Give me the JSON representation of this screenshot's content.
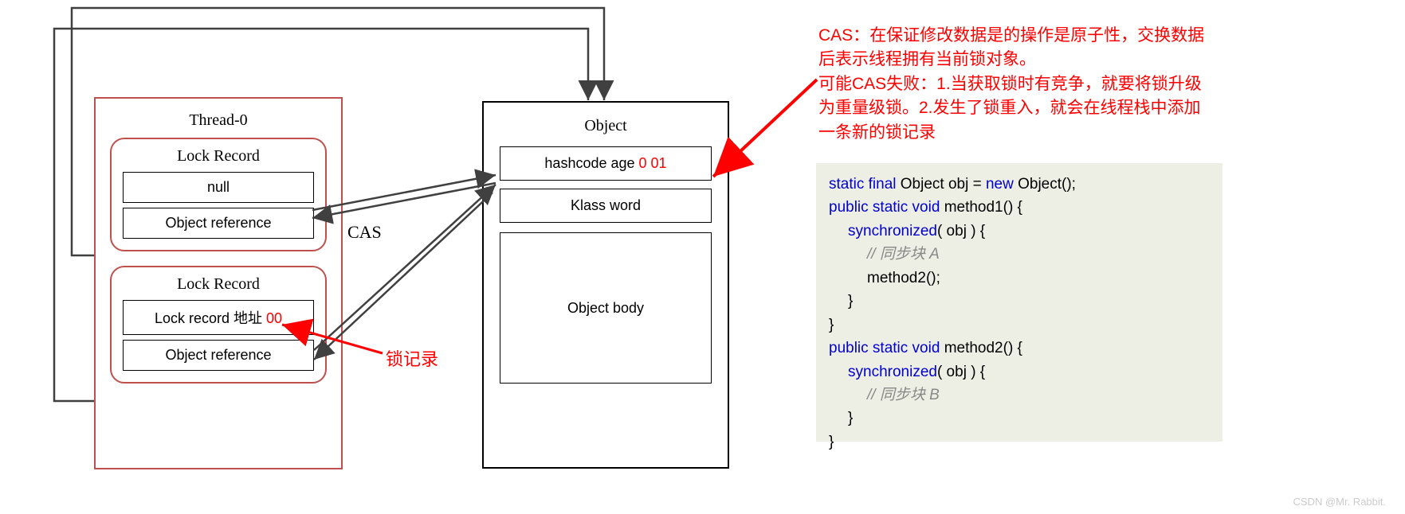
{
  "thread": {
    "title": "Thread-0",
    "lock_records": [
      {
        "title": "Lock Record",
        "row1": "null",
        "row2": "Object reference"
      },
      {
        "title": "Lock Record",
        "row1_prefix": "Lock record 地址 ",
        "row1_suffix": "00",
        "row2": "Object reference"
      }
    ]
  },
  "object": {
    "title": "Object",
    "mark_prefix": "hashcode age ",
    "mark_suffix": "0 01",
    "klass": "Klass word",
    "body": "Object body"
  },
  "cas_label": "CAS",
  "lockrec_label": "锁记录",
  "note": {
    "line1_prefix": "CAS：",
    "line1_rest": "在保证修改数据是的操作是原子性，交换数据后表示线程拥有当前锁对象。",
    "line2": "可能CAS失败：1.当获取锁时有竞争，就要将锁升级为重量级锁。2.发生了锁重入，就会在线程栈中添加一条新的锁记录"
  },
  "code": {
    "l1_a": "static final ",
    "l1_b": "Object obj = ",
    "l1_c": "new ",
    "l1_d": "Object();",
    "l2_a": "public static void ",
    "l2_b": "method1() {",
    "l3_a": "synchronized",
    "l3_b": "( obj ) {",
    "l4": "// 同步块 A",
    "l5": "method2();",
    "l6": "}",
    "l7": "}",
    "l8_a": "public static void ",
    "l8_b": "method2() {",
    "l9_a": "synchronized",
    "l9_b": "( obj ) {",
    "l10": "// 同步块 B",
    "l11": "}",
    "l12": "}"
  },
  "watermark": "CSDN @Mr. Rabbit."
}
